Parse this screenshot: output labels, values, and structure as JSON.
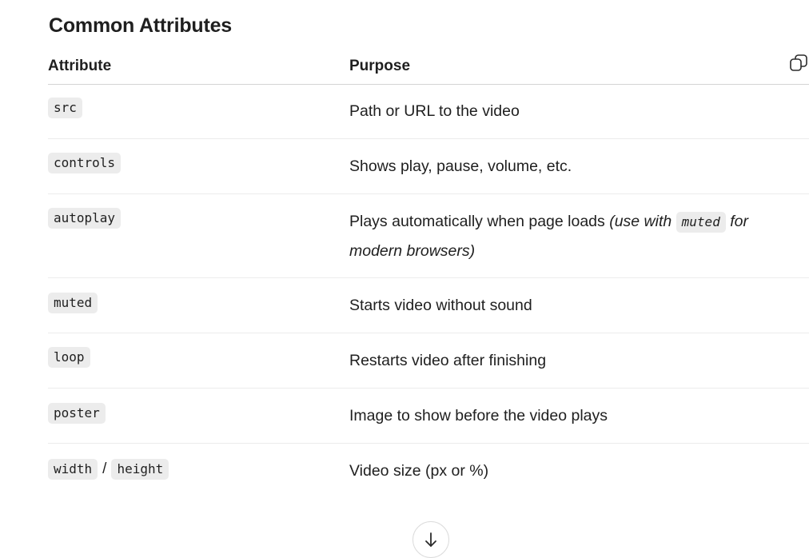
{
  "section": {
    "title": "Common Attributes"
  },
  "table": {
    "headers": {
      "attribute": "Attribute",
      "purpose": "Purpose"
    },
    "rows": [
      {
        "attribute": "src",
        "purpose": "Path or URL to the video"
      },
      {
        "attribute": "controls",
        "purpose": "Shows play, pause, volume, etc."
      },
      {
        "attribute": "autoplay",
        "purpose": "Plays automatically when page loads",
        "note_before": "(use with",
        "note_code": "muted",
        "note_after": "for modern browsers)"
      },
      {
        "attribute": "muted",
        "purpose": "Starts video without sound"
      },
      {
        "attribute": "loop",
        "purpose": "Restarts video after finishing"
      },
      {
        "attribute": "poster",
        "purpose": "Image to show before the video plays"
      },
      {
        "attribute": "width",
        "separator": "/",
        "attribute_2": "height",
        "purpose": "Video size (px or %)"
      }
    ]
  },
  "icons": {
    "copy": "copy-icon",
    "scroll_down": "arrow-down-icon"
  }
}
